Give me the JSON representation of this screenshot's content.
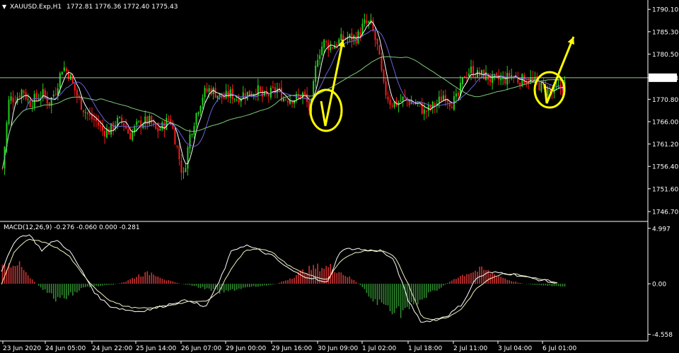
{
  "header": {
    "symbol": "XAUUSD.Exp,H1",
    "ohlc": "1772.81 1776.36 1772.40 1775.43",
    "arrow_glyph": "▼"
  },
  "macd_header": "MACD(12,26,9) -0.276 -0.060 0.000 -0.281",
  "colors": {
    "background": "#000000",
    "bull_candle": "#22d11f",
    "bear_candle": "#ff1a1a",
    "ma_fast": "#ffffff",
    "ma_mid": "#6a63d8",
    "ma_slow": "#7ec97a",
    "annotation": "#ffff00",
    "macd_hist_up": "#cc3333",
    "macd_hist_down": "#2e8b2e"
  },
  "chart_data": [
    {
      "type": "candlestick",
      "symbol": "XAUUSD",
      "timeframe": "H1",
      "ylim": [
        1745.5,
        1791.5
      ],
      "yticks": [
        "1790.10",
        "1785.30",
        "1780.50",
        "1775.43",
        "1770.80",
        "1766.00",
        "1761.20",
        "1756.40",
        "1751.60",
        "1746.70"
      ],
      "yticks_values": [
        1790.1,
        1785.3,
        1780.5,
        1775.43,
        1770.8,
        1766.0,
        1761.2,
        1756.4,
        1751.6,
        1746.7
      ],
      "current_price": "1775.43",
      "xticks": [
        "23 Jun 2020",
        "24 Jun 05:00",
        "24 Jun 22:00",
        "25 Jun 14:00",
        "26 Jun 07:00",
        "29 Jun 00:00",
        "29 Jun 16:00",
        "30 Jun 09:00",
        "1 Jul 02:00",
        "1 Jul 18:00",
        "2 Jul 11:00",
        "3 Jul 04:00",
        "6 Jul 01:00"
      ],
      "close_path": [
        1756,
        1771,
        1771,
        1773,
        1770,
        1771,
        1772,
        1770,
        1773,
        1778,
        1776,
        1772,
        1769,
        1767,
        1766,
        1764,
        1764,
        1766,
        1766,
        1763,
        1765,
        1766,
        1766,
        1764,
        1765,
        1767,
        1761,
        1754,
        1763,
        1768,
        1772,
        1773,
        1772,
        1771,
        1772,
        1771,
        1772,
        1772,
        1773,
        1771,
        1772,
        1773,
        1771,
        1771,
        1771,
        1772,
        1768,
        1780,
        1783,
        1782,
        1783,
        1784,
        1784,
        1784,
        1787,
        1787,
        1782,
        1773,
        1770,
        1770,
        1771,
        1770,
        1770,
        1768,
        1769,
        1770,
        1772,
        1770,
        1771,
        1776,
        1777,
        1776,
        1776,
        1775,
        1775,
        1775,
        1776,
        1775,
        1775,
        1775,
        1774,
        1773,
        1772,
        1773,
        1774
      ]
    },
    {
      "type": "macd",
      "params": "12,26,9",
      "ylim": [
        -4.9,
        5.3
      ],
      "yticks": [
        "4.997",
        "0.00",
        "-4.558"
      ],
      "yticks_values": [
        4.997,
        0.0,
        -4.558
      ],
      "macd_path": [
        1,
        4,
        4.5,
        3,
        4,
        3,
        1,
        -1,
        -2,
        -2.3,
        -2.5,
        -2.3,
        -2,
        -1.6,
        -1.5,
        -2.2,
        0,
        3,
        3.5,
        3,
        2.5,
        1.5,
        0.8,
        0.5,
        0,
        3,
        3.2,
        3,
        3,
        2,
        -1.5,
        -3.5,
        -3.2,
        -2.8,
        -1.8,
        0.5,
        1,
        1,
        0.8,
        0.5,
        0.3,
        0
      ],
      "signal_path": [
        0,
        3,
        4,
        3.8,
        3.3,
        2.5,
        0.8,
        -0.5,
        -1.5,
        -2,
        -2.2,
        -2.2,
        -2,
        -1.8,
        -1.6,
        -1.6,
        -0.8,
        1.5,
        3,
        3.2,
        2.8,
        1.8,
        1.1,
        0.7,
        0.3,
        2,
        2.8,
        3,
        3,
        2.5,
        0,
        -3,
        -3.3,
        -3,
        -2.2,
        -0.5,
        0.5,
        0.9,
        0.9,
        0.6,
        0.4,
        0.1
      ],
      "hist_path": [
        1.5,
        2,
        0.5,
        -0.5,
        -1.5,
        -1,
        -0.3,
        -0.2,
        -0.1,
        0.2,
        0.8,
        1,
        0.3,
        0,
        -0.2,
        -0.5,
        -0.8,
        -0.5,
        -0.3,
        -0.2,
        0,
        0.5,
        1.2,
        1.5,
        1.5,
        0.8,
        0,
        -1.5,
        -2,
        -2.5,
        -2,
        -1,
        -0.3,
        0.5,
        1,
        1.3,
        0.8,
        0.3,
        0,
        -0.1,
        -0.2,
        -0.3
      ]
    }
  ]
}
